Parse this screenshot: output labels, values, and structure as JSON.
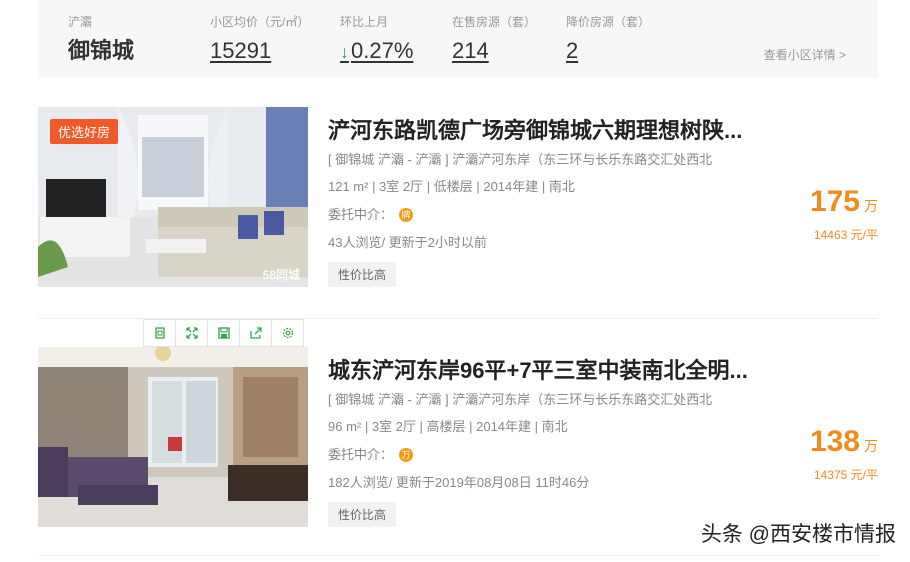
{
  "community": {
    "district_label": "浐灞",
    "name": "御锦城",
    "avg_price_label": "小区均价（元/㎡）",
    "avg_price": "15291",
    "mom_label": "环比上月",
    "mom_value": "0.27%",
    "mom_direction": "down",
    "on_sale_label": "在售房源（套）",
    "on_sale": "214",
    "reduced_label": "降价房源（套）",
    "reduced": "2",
    "detail_link": "查看小区详情 >",
    "colors": {
      "trend_down": "#2fa84f",
      "price": "#f08c1e",
      "badge": "#f05a28"
    }
  },
  "listings": [
    {
      "badge": "优选好房",
      "photo_watermark": "58同城",
      "title": "浐河东路凯德广场旁御锦城六期理想树陕...",
      "location": "[ 御锦城 浐灞 - 浐灞 ] 浐灞浐河东岸（东三环与长乐东路交汇处西北",
      "meta": "121 m² | 3室 2厅 | 低楼层 | 2014年建 | 南北",
      "agent_label": "委托中介：",
      "agent_badge": "牌",
      "views": "43人浏览/ 更新于2小时以前",
      "tag": "性价比高",
      "price": "175",
      "price_unit": "万",
      "unit_price": "14463 元/平"
    },
    {
      "toolbar": [
        "crop-icon",
        "expand-icon",
        "save-icon",
        "share-icon",
        "settings-icon"
      ],
      "title": "城东浐河东岸96平+7平三室中装南北全明...",
      "location": "[ 御锦城 浐灞 - 浐灞 ] 浐灞浐河东岸（东三环与长乐东路交汇处西北",
      "meta": "96 m² | 3室 2厅 | 高楼层 | 2014年建 | 南北",
      "agent_label": "委托中介：",
      "agent_badge": "万",
      "views": "182人浏览/ 更新于2019年08月08日 11时46分",
      "tag": "性价比高",
      "price": "138",
      "price_unit": "万",
      "unit_price": "14375 元/平"
    }
  ],
  "footer_watermark": "头条 @西安楼市情报"
}
